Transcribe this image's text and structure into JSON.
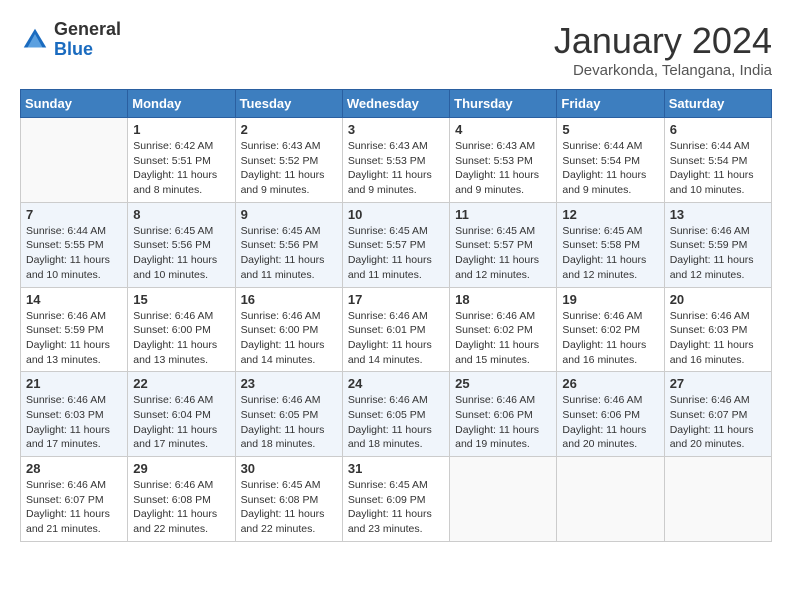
{
  "header": {
    "logo_general": "General",
    "logo_blue": "Blue",
    "month_title": "January 2024",
    "location": "Devarkonda, Telangana, India"
  },
  "days_of_week": [
    "Sunday",
    "Monday",
    "Tuesday",
    "Wednesday",
    "Thursday",
    "Friday",
    "Saturday"
  ],
  "weeks": [
    [
      {
        "day": "",
        "info": ""
      },
      {
        "day": "1",
        "info": "Sunrise: 6:42 AM\nSunset: 5:51 PM\nDaylight: 11 hours\nand 8 minutes."
      },
      {
        "day": "2",
        "info": "Sunrise: 6:43 AM\nSunset: 5:52 PM\nDaylight: 11 hours\nand 9 minutes."
      },
      {
        "day": "3",
        "info": "Sunrise: 6:43 AM\nSunset: 5:53 PM\nDaylight: 11 hours\nand 9 minutes."
      },
      {
        "day": "4",
        "info": "Sunrise: 6:43 AM\nSunset: 5:53 PM\nDaylight: 11 hours\nand 9 minutes."
      },
      {
        "day": "5",
        "info": "Sunrise: 6:44 AM\nSunset: 5:54 PM\nDaylight: 11 hours\nand 9 minutes."
      },
      {
        "day": "6",
        "info": "Sunrise: 6:44 AM\nSunset: 5:54 PM\nDaylight: 11 hours\nand 10 minutes."
      }
    ],
    [
      {
        "day": "7",
        "info": "Sunrise: 6:44 AM\nSunset: 5:55 PM\nDaylight: 11 hours\nand 10 minutes."
      },
      {
        "day": "8",
        "info": "Sunrise: 6:45 AM\nSunset: 5:56 PM\nDaylight: 11 hours\nand 10 minutes."
      },
      {
        "day": "9",
        "info": "Sunrise: 6:45 AM\nSunset: 5:56 PM\nDaylight: 11 hours\nand 11 minutes."
      },
      {
        "day": "10",
        "info": "Sunrise: 6:45 AM\nSunset: 5:57 PM\nDaylight: 11 hours\nand 11 minutes."
      },
      {
        "day": "11",
        "info": "Sunrise: 6:45 AM\nSunset: 5:57 PM\nDaylight: 11 hours\nand 12 minutes."
      },
      {
        "day": "12",
        "info": "Sunrise: 6:45 AM\nSunset: 5:58 PM\nDaylight: 11 hours\nand 12 minutes."
      },
      {
        "day": "13",
        "info": "Sunrise: 6:46 AM\nSunset: 5:59 PM\nDaylight: 11 hours\nand 12 minutes."
      }
    ],
    [
      {
        "day": "14",
        "info": "Sunrise: 6:46 AM\nSunset: 5:59 PM\nDaylight: 11 hours\nand 13 minutes."
      },
      {
        "day": "15",
        "info": "Sunrise: 6:46 AM\nSunset: 6:00 PM\nDaylight: 11 hours\nand 13 minutes."
      },
      {
        "day": "16",
        "info": "Sunrise: 6:46 AM\nSunset: 6:00 PM\nDaylight: 11 hours\nand 14 minutes."
      },
      {
        "day": "17",
        "info": "Sunrise: 6:46 AM\nSunset: 6:01 PM\nDaylight: 11 hours\nand 14 minutes."
      },
      {
        "day": "18",
        "info": "Sunrise: 6:46 AM\nSunset: 6:02 PM\nDaylight: 11 hours\nand 15 minutes."
      },
      {
        "day": "19",
        "info": "Sunrise: 6:46 AM\nSunset: 6:02 PM\nDaylight: 11 hours\nand 16 minutes."
      },
      {
        "day": "20",
        "info": "Sunrise: 6:46 AM\nSunset: 6:03 PM\nDaylight: 11 hours\nand 16 minutes."
      }
    ],
    [
      {
        "day": "21",
        "info": "Sunrise: 6:46 AM\nSunset: 6:03 PM\nDaylight: 11 hours\nand 17 minutes."
      },
      {
        "day": "22",
        "info": "Sunrise: 6:46 AM\nSunset: 6:04 PM\nDaylight: 11 hours\nand 17 minutes."
      },
      {
        "day": "23",
        "info": "Sunrise: 6:46 AM\nSunset: 6:05 PM\nDaylight: 11 hours\nand 18 minutes."
      },
      {
        "day": "24",
        "info": "Sunrise: 6:46 AM\nSunset: 6:05 PM\nDaylight: 11 hours\nand 18 minutes."
      },
      {
        "day": "25",
        "info": "Sunrise: 6:46 AM\nSunset: 6:06 PM\nDaylight: 11 hours\nand 19 minutes."
      },
      {
        "day": "26",
        "info": "Sunrise: 6:46 AM\nSunset: 6:06 PM\nDaylight: 11 hours\nand 20 minutes."
      },
      {
        "day": "27",
        "info": "Sunrise: 6:46 AM\nSunset: 6:07 PM\nDaylight: 11 hours\nand 20 minutes."
      }
    ],
    [
      {
        "day": "28",
        "info": "Sunrise: 6:46 AM\nSunset: 6:07 PM\nDaylight: 11 hours\nand 21 minutes."
      },
      {
        "day": "29",
        "info": "Sunrise: 6:46 AM\nSunset: 6:08 PM\nDaylight: 11 hours\nand 22 minutes."
      },
      {
        "day": "30",
        "info": "Sunrise: 6:45 AM\nSunset: 6:08 PM\nDaylight: 11 hours\nand 22 minutes."
      },
      {
        "day": "31",
        "info": "Sunrise: 6:45 AM\nSunset: 6:09 PM\nDaylight: 11 hours\nand 23 minutes."
      },
      {
        "day": "",
        "info": ""
      },
      {
        "day": "",
        "info": ""
      },
      {
        "day": "",
        "info": ""
      }
    ]
  ]
}
